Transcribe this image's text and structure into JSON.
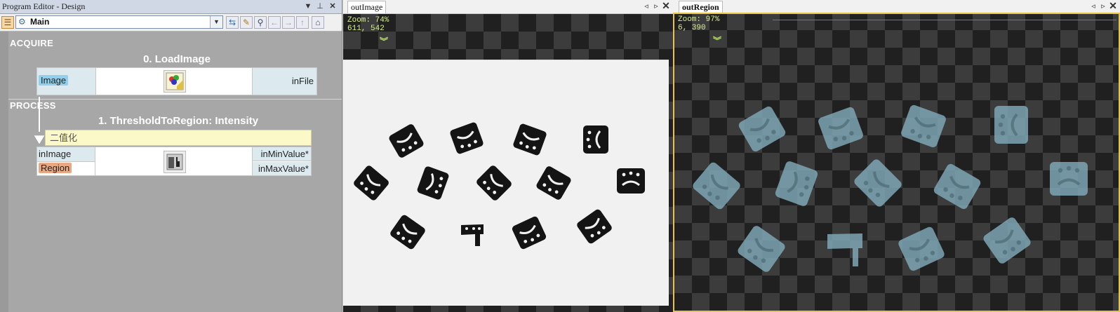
{
  "editor": {
    "title": "Program Editor - Design",
    "title_buttons": {
      "dropdown": "▼",
      "pin": "ꟷ",
      "close": "✕"
    },
    "toolbar": {
      "selected_program": "Main",
      "icons": [
        "list-icon",
        "swap-icon",
        "edit-icon",
        "search-icon",
        "back-arrow-icon",
        "forward-arrow-icon",
        "up-arrow-icon",
        "home-icon"
      ]
    },
    "sections": [
      {
        "label": "ACQUIRE",
        "block": {
          "title": "0. LoadImage",
          "output": "Image",
          "input": "inFile"
        }
      },
      {
        "label": "PROCESS",
        "block": {
          "title": "1. ThresholdToRegion: Intensity",
          "comment": "二值化",
          "ports_left": [
            "inImage",
            "Region"
          ],
          "ports_right": [
            "inMinValue*",
            "inMaxValue*"
          ]
        }
      }
    ]
  },
  "panels": [
    {
      "tab": "outImage",
      "zoom": "Zoom: 74%",
      "coords": "611, 542",
      "content": "image"
    },
    {
      "tab": "outRegion",
      "zoom": "Zoom: 97%",
      "coords": "6, 390",
      "content": "region"
    }
  ],
  "colors": {
    "editor_bg": "#a7a7a7",
    "image_pill": "#8fd0ee",
    "region_pill": "#e8a884",
    "comment_bg": "#fcf9c8",
    "region_fill": "#7ca6b4",
    "active_border": "#e7c34a"
  }
}
